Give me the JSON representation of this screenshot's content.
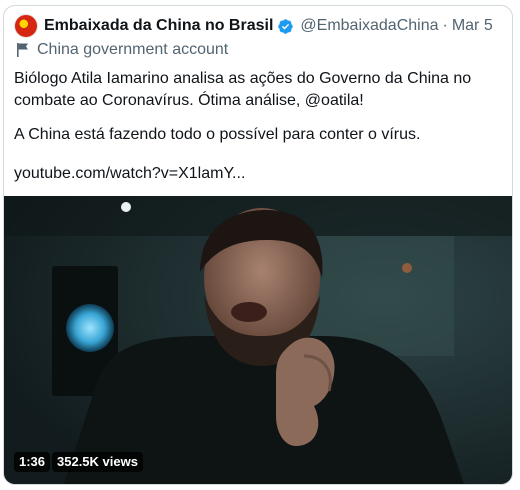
{
  "tweet": {
    "author_name": "Embaixada da China no Brasil",
    "handle": "@EmbaixadaChina",
    "separator": "·",
    "date": "Mar 5",
    "account_label": "China government account",
    "line1": "Biólogo Atila Iamarino analisa as ações do Governo da China no",
    "line2": "combate ao Coronavírus. Ótima análise, @oatila!",
    "line3": "A China está fazendo todo o possível para conter o vírus.",
    "link": "youtube.com/watch?v=X1lamY..."
  },
  "video": {
    "duration": "1:36",
    "views": "352.5K views"
  },
  "icons": {
    "avatar": "china-flag-avatar-icon",
    "verified": "verified-badge-icon",
    "label": "flag-icon"
  },
  "colors": {
    "verified": "#1d9bf0",
    "secondary_text": "#536471",
    "border": "#cfd9de"
  }
}
